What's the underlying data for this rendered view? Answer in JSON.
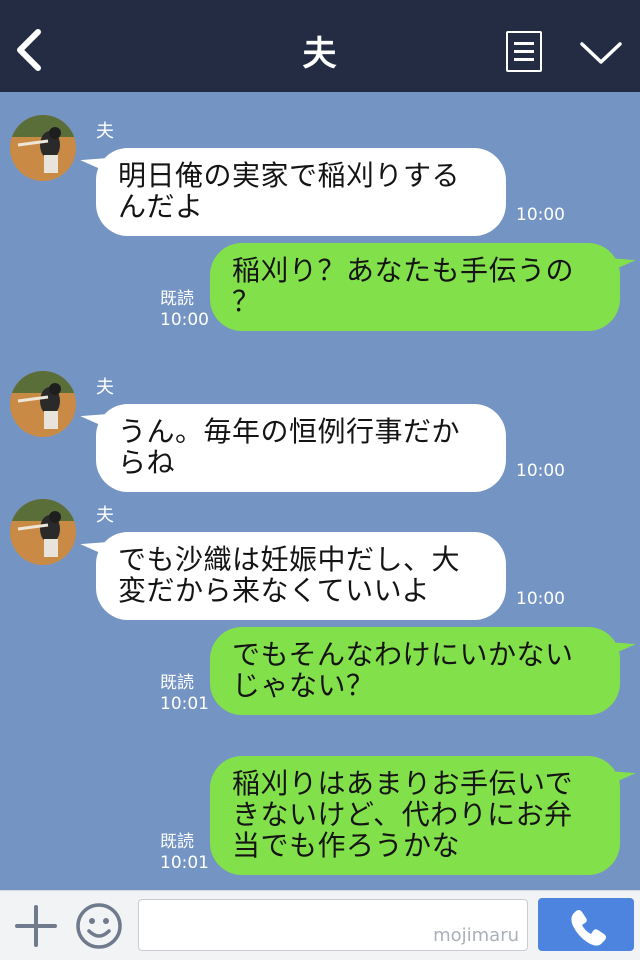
{
  "header": {
    "title": "夫",
    "back_icon": "chevron-left-icon",
    "note_icon": "note-icon",
    "menu_icon": "chevron-down-icon",
    "background": "#232c42"
  },
  "chat": {
    "background": "#7494c4",
    "messages": [
      {
        "side": "in",
        "sender": "夫",
        "text": "明日俺の実家で稲刈りする\nんだよ",
        "time": "10:00"
      },
      {
        "side": "out",
        "read": "既読",
        "text": "稲刈り？あなたも手伝うの\n？",
        "time": "10:00"
      },
      {
        "side": "in",
        "sender": "夫",
        "text": "うん。毎年の恒例行事だか\nらね",
        "time": "10:00"
      },
      {
        "side": "in",
        "sender": "夫",
        "text": "でも沙織は妊娠中だし、大\n変だから来なくていいよ",
        "time": "10:00"
      },
      {
        "side": "out",
        "read": "既読",
        "text": "でもそんなわけにいかない\nじゃない？",
        "time": "10:01"
      },
      {
        "side": "out",
        "read": "既読",
        "text": "稲刈りはあまりお手伝いで\nきないけど、代わりにお弁\n当でも作ろうかな",
        "time": "10:01"
      }
    ],
    "incoming_color": "#ffffff",
    "outgoing_color": "#82e04a"
  },
  "input_bar": {
    "plus_icon": "plus-icon",
    "emoji_icon": "smiley-icon",
    "placeholder": "",
    "watermark": "mojimaru",
    "call_icon": "phone-icon",
    "call_color": "#4c84e0"
  }
}
